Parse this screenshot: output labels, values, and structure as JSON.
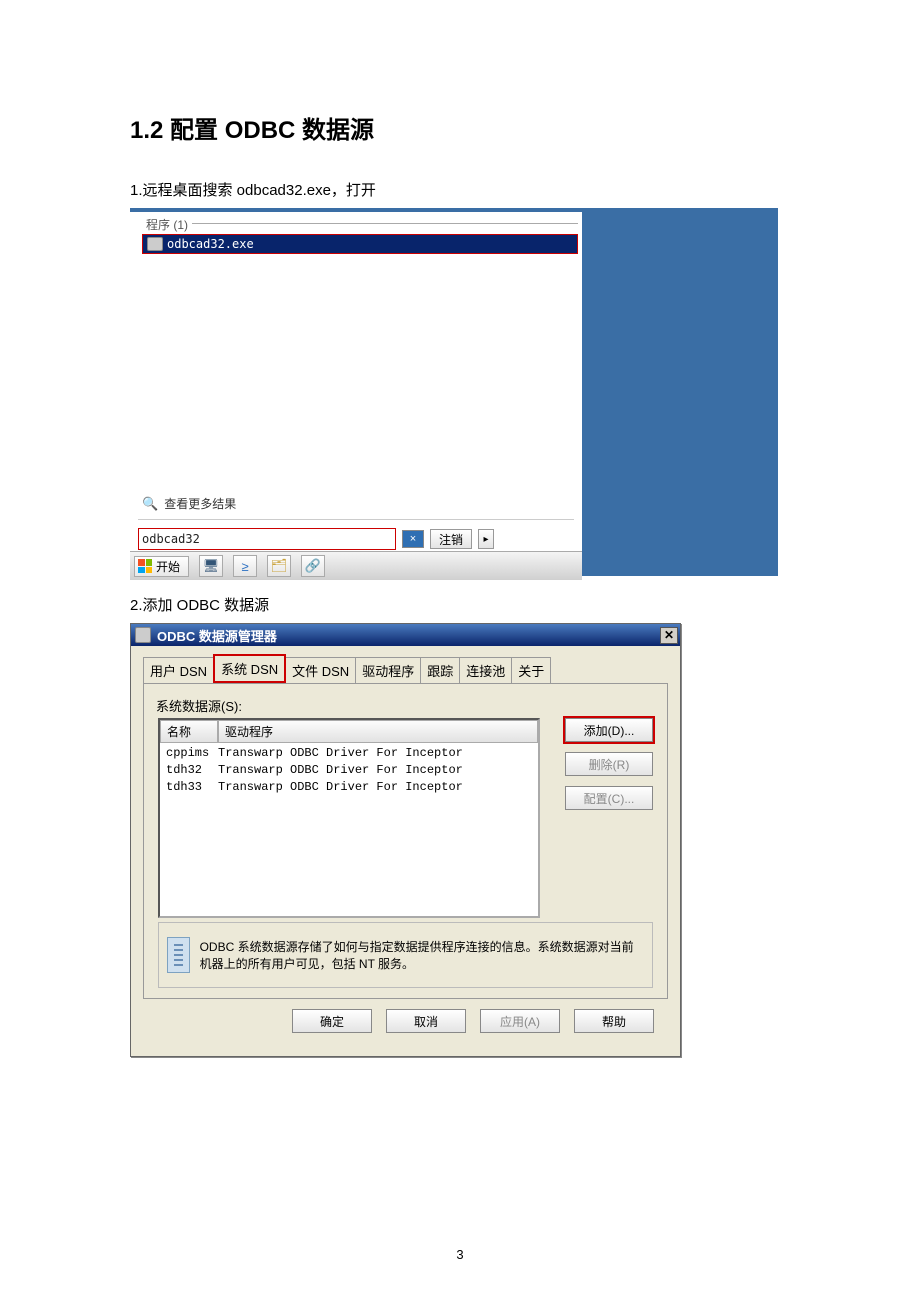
{
  "heading": "1.2 配置 ODBC 数据源",
  "step1": "1.远程桌面搜索 odbcad32.exe，打开",
  "step2": "2.添加 ODBC 数据源",
  "search_panel": {
    "group_label": "程序 (1)",
    "item": "odbcad32.exe",
    "more_results": "查看更多结果",
    "search_value": "odbcad32",
    "clear": "×",
    "logout": "注销",
    "arrow": "▸",
    "start": "开始"
  },
  "odbc": {
    "title": "ODBC 数据源管理器",
    "tabs": [
      "用户 DSN",
      "系统 DSN",
      "文件 DSN",
      "驱动程序",
      "跟踪",
      "连接池",
      "关于"
    ],
    "section_label": "系统数据源(S):",
    "col_name": "名称",
    "col_driver": "驱动程序",
    "rows": [
      {
        "name": "cppims",
        "driver": "Transwarp ODBC Driver For Inceptor"
      },
      {
        "name": "tdh32",
        "driver": "Transwarp ODBC Driver For Inceptor"
      },
      {
        "name": "tdh33",
        "driver": "Transwarp ODBC Driver For Inceptor"
      }
    ],
    "btn_add": "添加(D)...",
    "btn_del": "删除(R)",
    "btn_cfg": "配置(C)...",
    "info_text": "ODBC 系统数据源存储了如何与指定数据提供程序连接的信息。系统数据源对当前机器上的所有用户可见，包括 NT 服务。",
    "ok": "确定",
    "cancel": "取消",
    "apply": "应用(A)",
    "help": "帮助"
  },
  "page_number": "3"
}
